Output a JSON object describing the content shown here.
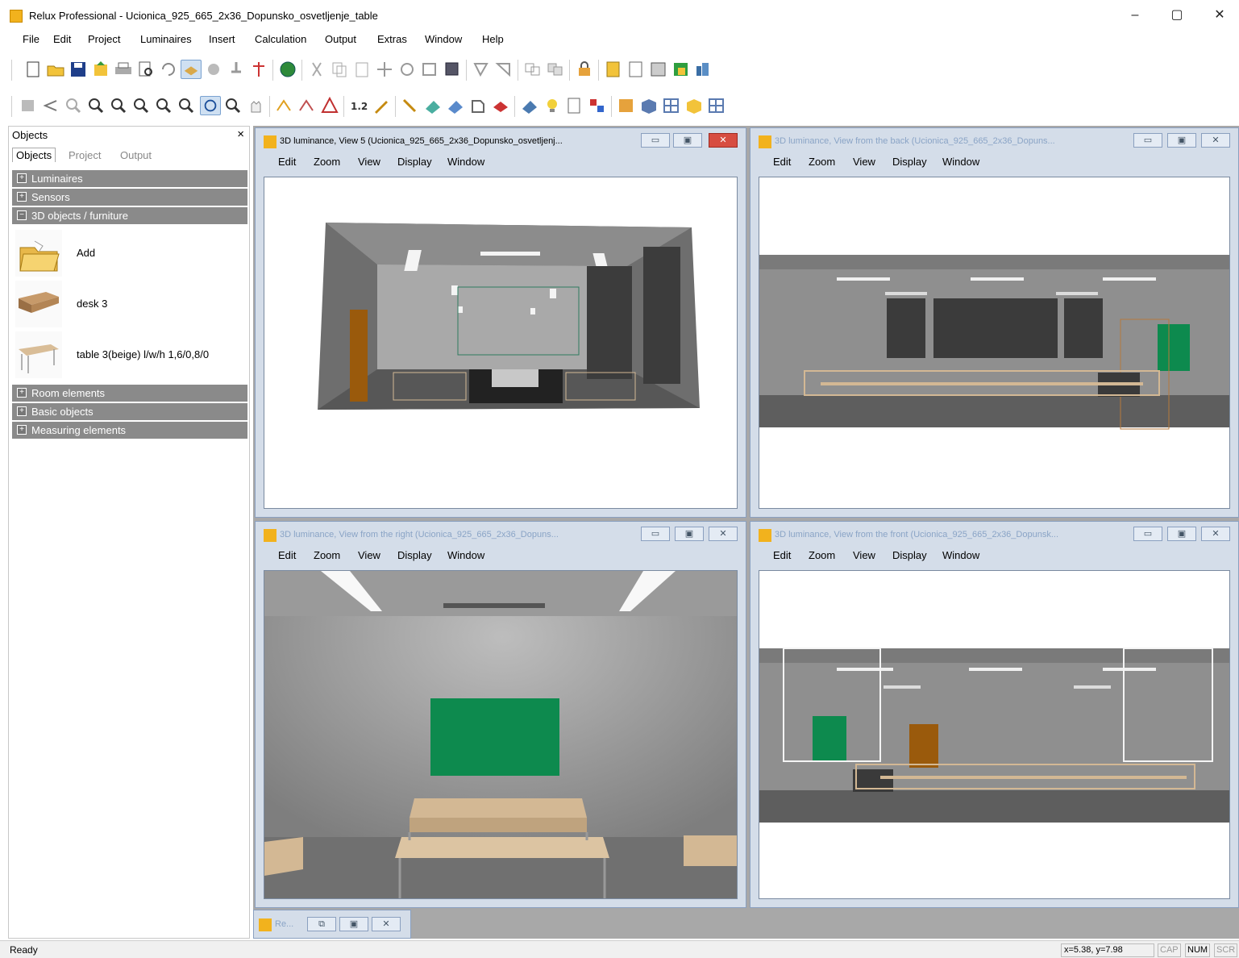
{
  "app": {
    "title": "Relux Professional - Ucionica_925_665_2x36_Dopunsko_osvetljenje_table",
    "controls": {
      "minimize": "–",
      "maximize": "▢",
      "close": "✕"
    }
  },
  "menu": [
    "File",
    "Edit",
    "Project",
    "Luminaires",
    "Insert",
    "Calculation",
    "Output",
    "Extras",
    "Window",
    "Help"
  ],
  "panel": {
    "title": "Objects",
    "close": "×",
    "tabs": [
      "Objects",
      "Project",
      "Output"
    ],
    "groups_top": [
      {
        "sign": "+",
        "label": "Luminaires"
      },
      {
        "sign": "+",
        "label": "Sensors"
      },
      {
        "sign": "−",
        "label": "3D objects / furniture"
      }
    ],
    "items": [
      {
        "label": "Add",
        "icon": "folder-open-icon"
      },
      {
        "label": "desk 3",
        "icon": "desk-icon"
      },
      {
        "label": "table 3(beige) l/w/h 1,6/0,8/0",
        "icon": "table-icon"
      }
    ],
    "groups_bottom": [
      {
        "sign": "+",
        "label": "Room elements"
      },
      {
        "sign": "+",
        "label": "Basic objects"
      },
      {
        "sign": "+",
        "label": "Measuring elements"
      }
    ]
  },
  "windows": [
    {
      "title": "3D luminance, View 5 (Ucionica_925_665_2x36_Dopunsko_osvetljenj...",
      "active": true
    },
    {
      "title": "3D luminance, View from the back (Ucionica_925_665_2x36_Dopuns...",
      "active": false
    },
    {
      "title": "3D luminance, View from the right (Ucionica_925_665_2x36_Dopuns...",
      "active": false
    },
    {
      "title": "3D luminance, View from the front (Ucionica_925_665_2x36_Dopunsk...",
      "active": false
    }
  ],
  "window_menu": [
    "Edit",
    "Zoom",
    "View",
    "Display",
    "Window"
  ],
  "minimized": {
    "title": "Re..."
  },
  "status": {
    "text": "Ready",
    "coords": "x=5.38, y=7.98",
    "indicators": [
      {
        "label": "CAP",
        "on": false
      },
      {
        "label": "NUM",
        "on": true
      },
      {
        "label": "SCR",
        "on": false
      }
    ]
  },
  "colors": {
    "board_green": "#0d8a4e",
    "door_brown": "#9a5a0c",
    "table_beige": "#d3b894",
    "wall_grey": "#8c8c8c"
  }
}
